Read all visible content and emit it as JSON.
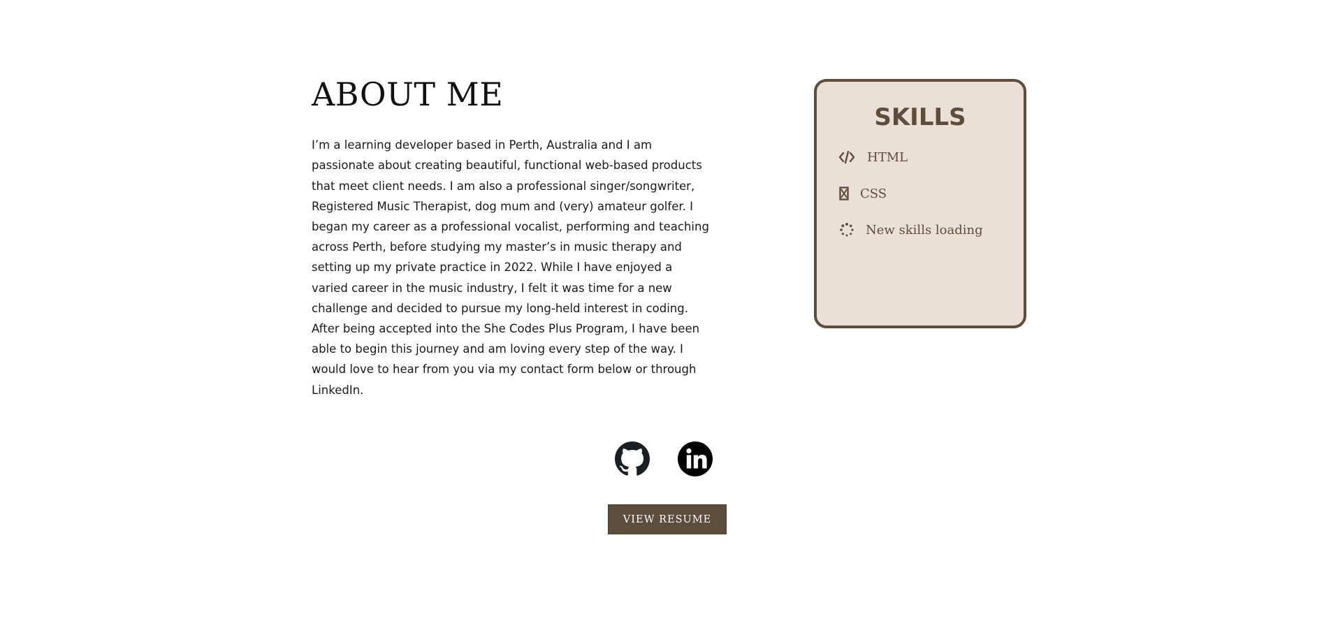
{
  "about": {
    "title": "ABOUT ME",
    "text": "I’m a learning developer based in Perth, Australia and I am passionate about creating beautiful, functional web-based products that meet client needs. I am also a professional singer/songwriter, Registered Music Therapist, dog mum and (very) amateur golfer. I began my career as a professional vocalist, performing and teaching across Perth, before studying my master’s in music therapy and setting up my private practice in 2022. While I have enjoyed a varied career in the music industry, I felt it was time for a new challenge and decided to pursue my long-held interest in coding. After being accepted into the She Codes Plus Program, I have been able to begin this journey and am loving every step of the way. I would love to hear from you via my contact form below or through LinkedIn."
  },
  "skills": {
    "title": "SKILLS",
    "items": [
      {
        "label": "HTML",
        "icon": "code-icon"
      },
      {
        "label": "CSS",
        "icon": "css-icon"
      },
      {
        "label": "New skills loading",
        "icon": "loading-icon"
      }
    ]
  },
  "social": {
    "items": [
      {
        "icon": "github-icon"
      },
      {
        "icon": "linkedin-icon"
      }
    ]
  },
  "resume": {
    "label": "VIEW RESUME"
  },
  "colors": {
    "accent": "#5c4d3c",
    "card_background": "#eae0d6",
    "text": "#1a1a1a",
    "background": "#ffffff"
  }
}
